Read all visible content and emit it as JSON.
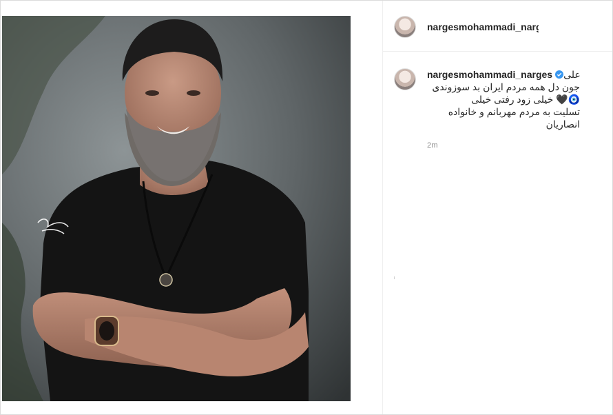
{
  "post": {
    "username": "nargesmohammadi_narge",
    "watermark_text": "سعید بهرامی"
  },
  "comment": {
    "username": "nargesmohammadi_narges",
    "first_word": "علی",
    "line1": "جون دل همه مردم ایران بد سوزوندی",
    "line2": "🧿🖤 خیلی زود رفتی خیلی",
    "line3": "تسلیت به مردم مهربانم و خانواده",
    "line4": "انصاریان",
    "time": "2m"
  },
  "icons": {
    "verified": "verified-badge-icon",
    "avatar": "profile-avatar"
  },
  "colors": {
    "verified": "#3897f0",
    "muted_text": "#8e8e8e",
    "text": "#262626",
    "border": "#dbdbdb"
  }
}
